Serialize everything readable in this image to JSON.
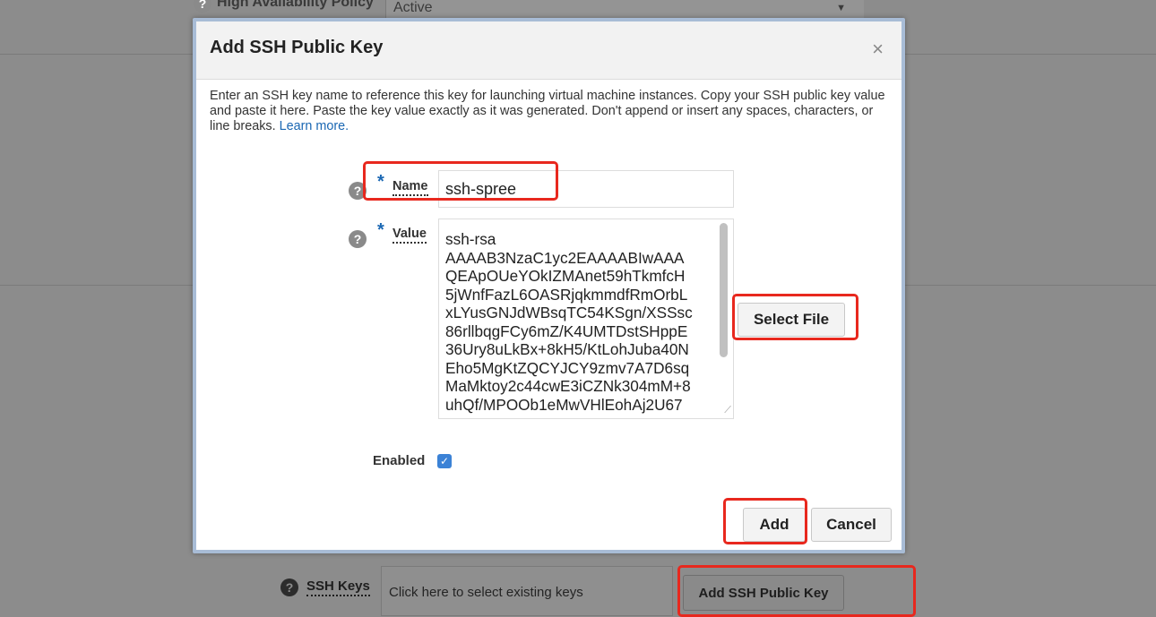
{
  "background": {
    "top_row": {
      "label": "High Availability Policy",
      "value": "Active"
    },
    "ssh_keys": {
      "label": "SSH Keys",
      "placeholder": "Click here to select existing keys",
      "add_button": "Add SSH Public Key"
    }
  },
  "dialog": {
    "title": "Add SSH Public Key",
    "close_glyph": "×",
    "description": "Enter an SSH key name to reference this key for launching virtual machine instances. Copy your SSH public key value and paste it here. Paste the key value exactly as it was generated. Don't append or insert any spaces, characters, or line breaks.",
    "learn_more": "Learn more.",
    "name_field": {
      "label": "Name",
      "value": "ssh-spree"
    },
    "value_field": {
      "label": "Value",
      "lines": [
        "ssh-rsa",
        "AAAAB3NzaC1yc2EAAAABIwAAA",
        "QEApOUeYOkIZMAnet59hTkmfcH",
        "5jWnfFazL6OASRjqkmmdfRmOrbL",
        "xLYusGNJdWBsqTC54KSgn/XSSsc",
        "86rllbqgFCy6mZ/K4UMTDstSHppE",
        "36Ury8uLkBx+8kH5/KtLohJuba40N",
        "Eho5MgKtZQCYJCY9zmv7A7D6sq",
        "MaMktoy2c44cwE3iCZNk304mM+8",
        "uhQf/MPOOb1eMwVHlEohAj2U67"
      ]
    },
    "select_file": "Select File",
    "enabled": {
      "label": "Enabled",
      "checked": true
    },
    "add_button": "Add",
    "cancel_button": "Cancel"
  },
  "colors": {
    "accent": "#1a67b3",
    "highlight": "#e8281e",
    "checkbox": "#3b82d6"
  },
  "icons": {
    "help": "help-circle-icon",
    "close": "close-icon",
    "check": "checkmark-icon"
  }
}
